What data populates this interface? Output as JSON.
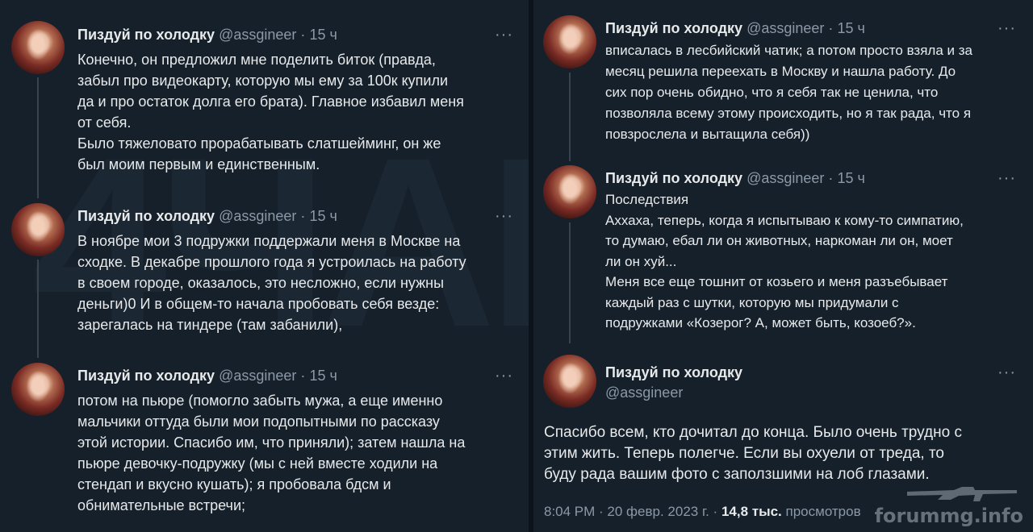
{
  "left_tweets": [
    {
      "name": "Пиздуй по холодку",
      "handle": "@assgineer",
      "time": "15 ч",
      "more": "···",
      "lines": [
        "Конечно, он предложил мне поделить биток (правда,",
        "забыл про видеокарту, которую мы ему за 100к купили",
        "да и про остаток долга его брата). Главное избавил меня",
        "от себя.",
        "Было тяжеловато прорабатывать слатшейминг, он же",
        "был моим первым и единственным."
      ]
    },
    {
      "name": "Пиздуй по холодку",
      "handle": "@assgineer",
      "time": "15 ч",
      "more": "···",
      "lines": [
        "В ноябре мои 3 подружки поддержали меня в Москве на",
        "сходке. В декабре прошлого года я устроилась на работу",
        "в своем городе, оказалось, это несложно, если нужны",
        "деньги)0 И в общем-то начала пробовать себя везде:",
        "зарегалась на тиндере (там забанили),"
      ]
    },
    {
      "name": "Пиздуй по холодку",
      "handle": "@assgineer",
      "time": "15 ч",
      "more": "···",
      "lines": [
        "потом на пьюре (помогло забыть мужа, а еще именно",
        "мальчики оттуда были мои подопытными по рассказу",
        "этой истории. Спасибо им, что приняли); затем нашла на",
        "пьюре девочку-подружку (мы с ней вместе ходили на",
        "стендап и вкусно кушать); я пробовала бдсм и",
        "обнимательные встречи;"
      ]
    }
  ],
  "right_tweets": [
    {
      "name": "Пиздуй по холодку",
      "handle": "@assgineer",
      "time": "15 ч",
      "more": "···",
      "lines": [
        "вписалась в лесбийский чатик; а потом просто взяла и за",
        "месяц решила переехать в Москву и нашла работу. До",
        "сих пор очень обидно, что я себя так не ценила, что",
        "позволяла всему этому происходить, но я так рада, что я",
        "повзрослела и вытащила себя))"
      ]
    },
    {
      "name": "Пиздуй по холодку",
      "handle": "@assgineer",
      "time": "15 ч",
      "more": "···",
      "lines": [
        "Последствия",
        "Аххаха, теперь, когда я испытываю к кому-то симпатию,",
        "то думаю, ебал ли он животных, наркоман ли он, моет",
        "ли он хуй...",
        "Меня все еще тошнит от козьего и меня разъебывает",
        "каждый раз с шутки, которую мы придумали с",
        "подружками «Козерог? А, может быть, козоеб?»."
      ]
    }
  ],
  "final_tweet": {
    "name": "Пиздуй по холодку",
    "handle": "@assgineer",
    "more": "···",
    "lines": [
      "Спасибо всем, кто дочитал до конца. Было очень трудно с",
      "этим жить. Теперь полегче. Если вы охуели от треда, то",
      "буду рада вашим фото с заползшими на лоб глазами."
    ],
    "time": "8:04 PM · 20 февр. 2023 г. ·",
    "views_count": "14,8 тыс.",
    "views_label": "просмотров"
  },
  "watermark_text": "4ЧАН",
  "forum_watermark": "forummg.info"
}
